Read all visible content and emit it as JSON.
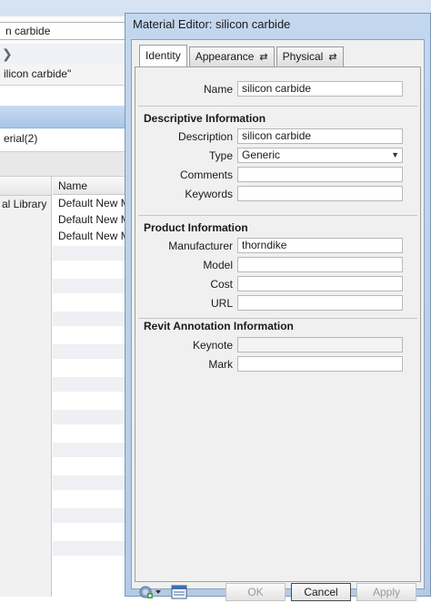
{
  "background_window": {
    "search_value": "n carbide",
    "header_text": "ilicon carbide\"",
    "material_row": "erial(2)",
    "library_column_label": "al Library",
    "name_column_header": "Name",
    "rows": [
      "Default New M",
      "Default New M",
      "Default New M"
    ]
  },
  "dialog": {
    "title": "Material Editor: silicon carbide",
    "tabs": [
      {
        "label": "Identity",
        "swap": ""
      },
      {
        "label": "Appearance",
        "swap": "⇄"
      },
      {
        "label": "Physical",
        "swap": "⇄"
      }
    ],
    "name_label": "Name",
    "name_value": "silicon carbide",
    "sections": {
      "descriptive": "Descriptive Information",
      "product": "Product Information",
      "revit": "Revit Annotation Information"
    },
    "fields": {
      "description": {
        "label": "Description",
        "value": "silicon carbide"
      },
      "type": {
        "label": "Type",
        "value": "Generic"
      },
      "comments": {
        "label": "Comments",
        "value": ""
      },
      "keywords": {
        "label": "Keywords",
        "value": ""
      },
      "manufacturer": {
        "label": "Manufacturer",
        "value": "thorndike"
      },
      "model": {
        "label": "Model",
        "value": ""
      },
      "cost": {
        "label": "Cost",
        "value": ""
      },
      "url": {
        "label": "URL",
        "value": ""
      },
      "keynote": {
        "label": "Keynote",
        "value": ""
      },
      "mark": {
        "label": "Mark",
        "value": ""
      }
    },
    "buttons": {
      "ok": "OK",
      "cancel": "Cancel",
      "apply": "Apply"
    },
    "icons": {
      "add_material": "add-material-icon",
      "browser": "material-browser-icon"
    }
  }
}
